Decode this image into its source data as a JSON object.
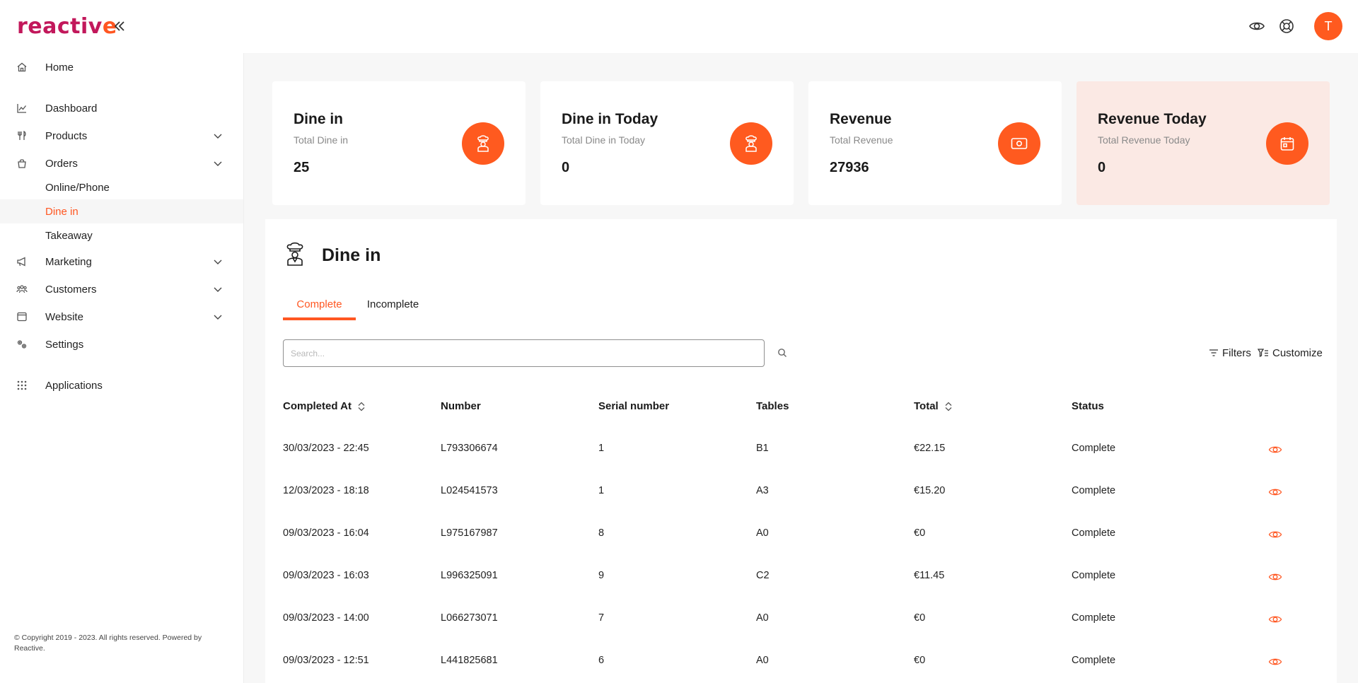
{
  "app": {
    "logo_main": "reactiv",
    "logo_accent": "e",
    "avatar_initial": "T"
  },
  "sidebar": {
    "items": [
      {
        "label": "Home",
        "icon": "home-icon"
      },
      {
        "label": "Dashboard",
        "icon": "chart-icon"
      },
      {
        "label": "Products",
        "icon": "utensils-icon"
      },
      {
        "label": "Orders",
        "icon": "bag-icon"
      },
      {
        "label": "Marketing",
        "icon": "megaphone-icon"
      },
      {
        "label": "Customers",
        "icon": "users-icon"
      },
      {
        "label": "Website",
        "icon": "browser-icon"
      },
      {
        "label": "Settings",
        "icon": "gears-icon"
      },
      {
        "label": "Applications",
        "icon": "grid-icon"
      }
    ],
    "orders_sub": [
      "Online/Phone",
      "Dine in",
      "Takeaway"
    ],
    "active_sub": "Dine in",
    "copyright": "© Copyright 2019 - 2023. All rights reserved. Powered by Reactive."
  },
  "stats": [
    {
      "title": "Dine in",
      "subtitle": "Total Dine in",
      "value": "25",
      "icon": "chef-icon"
    },
    {
      "title": "Dine in Today",
      "subtitle": "Total Dine in Today",
      "value": "0",
      "icon": "chef-icon"
    },
    {
      "title": "Revenue",
      "subtitle": "Total Revenue",
      "value": "27936",
      "icon": "cash-icon"
    },
    {
      "title": "Revenue Today",
      "subtitle": "Total Revenue Today",
      "value": "0",
      "icon": "calendar-icon"
    }
  ],
  "panel": {
    "title": "Dine in",
    "tabs": [
      "Complete",
      "Incomplete"
    ],
    "active_tab": "Complete",
    "search_placeholder": "Search...",
    "filters_label": "Filters",
    "customize_label": "Customize"
  },
  "table": {
    "columns": [
      "Completed At",
      "Number",
      "Serial number",
      "Tables",
      "Total",
      "Status"
    ],
    "rows": [
      [
        "30/03/2023 - 22:45",
        "L793306674",
        "1",
        "B1",
        "€22.15",
        "Complete"
      ],
      [
        "12/03/2023 - 18:18",
        "L024541573",
        "1",
        "A3",
        "€15.20",
        "Complete"
      ],
      [
        "09/03/2023 - 16:04",
        "L975167987",
        "8",
        "A0",
        "€0",
        "Complete"
      ],
      [
        "09/03/2023 - 16:03",
        "L996325091",
        "9",
        "C2",
        "€11.45",
        "Complete"
      ],
      [
        "09/03/2023 - 14:00",
        "L066273071",
        "7",
        "A0",
        "€0",
        "Complete"
      ],
      [
        "09/03/2023 - 12:51",
        "L441825681",
        "6",
        "A0",
        "€0",
        "Complete"
      ]
    ]
  },
  "colors": {
    "accent": "#ff5722",
    "brand": "#c2185b",
    "highlight_card": "#fbe9e4"
  }
}
